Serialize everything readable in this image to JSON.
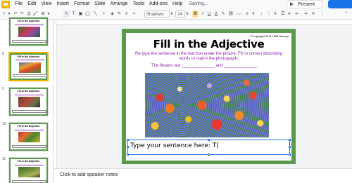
{
  "menu": [
    "File",
    "Edit",
    "View",
    "Insert",
    "Format",
    "Slide",
    "Arrange",
    "Tools",
    "Add-ons",
    "Help"
  ],
  "status": "Saving...",
  "present_label": "Present",
  "toolbar": {
    "font": "Shadows I...",
    "size": "24"
  },
  "slides": [
    {
      "num": "",
      "title": "Fill in the Adjective"
    },
    {
      "num": "8",
      "title": "Fill in the Adjective"
    },
    {
      "num": "9",
      "title": "Fill in the Adjective"
    },
    {
      "num": "10",
      "title": "Fill in the Adjective"
    },
    {
      "num": "11",
      "title": "Fill in the Adjective"
    }
  ],
  "slide": {
    "copyright": "©Copyright 2011 LMB Literacy",
    "title": "Fill in the Adjective",
    "instructions": "Re-type the sentence in the text box under the picture. Fill in correct describing words to match the photograph.",
    "prompt": "The flowers are ______________ and ______________.",
    "textbox": "Type your sentence here: T|"
  },
  "notes_placeholder": "Click to add speaker notes",
  "colors": {
    "slide_border": "#5b9a4c",
    "instruction_text": "#8e24aa",
    "selection": "#1a73e8",
    "share": "#1a73e8"
  }
}
